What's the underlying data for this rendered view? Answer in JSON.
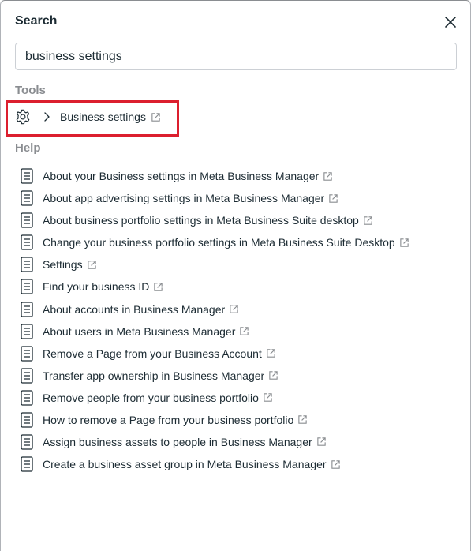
{
  "dialog": {
    "title": "Search"
  },
  "search": {
    "value": "business settings"
  },
  "tools": {
    "label": "Tools",
    "items": [
      {
        "label": "Business settings",
        "icon": "gear-icon"
      }
    ]
  },
  "help": {
    "label": "Help",
    "items": [
      {
        "label": "About your Business settings in Meta Business Manager"
      },
      {
        "label": "About app advertising settings in Meta Business Manager"
      },
      {
        "label": "About business portfolio settings in Meta Business Suite desktop"
      },
      {
        "label": "Change your business portfolio settings in Meta Business Suite Desktop"
      },
      {
        "label": "Settings"
      },
      {
        "label": "Find your business ID"
      },
      {
        "label": "About accounts in Business Manager"
      },
      {
        "label": "About users in Meta Business Manager"
      },
      {
        "label": "Remove a Page from your Business Account"
      },
      {
        "label": "Transfer app ownership in Business Manager"
      },
      {
        "label": "Remove people from your business portfolio"
      },
      {
        "label": "How to remove a Page from your business portfolio"
      },
      {
        "label": "Assign business assets to people in Business Manager"
      },
      {
        "label": "Create a business asset group in Meta Business Manager"
      }
    ]
  },
  "colors": {
    "highlight": "#dc1f2e",
    "text": "#1c2b33",
    "muted": "#8a8d91"
  }
}
